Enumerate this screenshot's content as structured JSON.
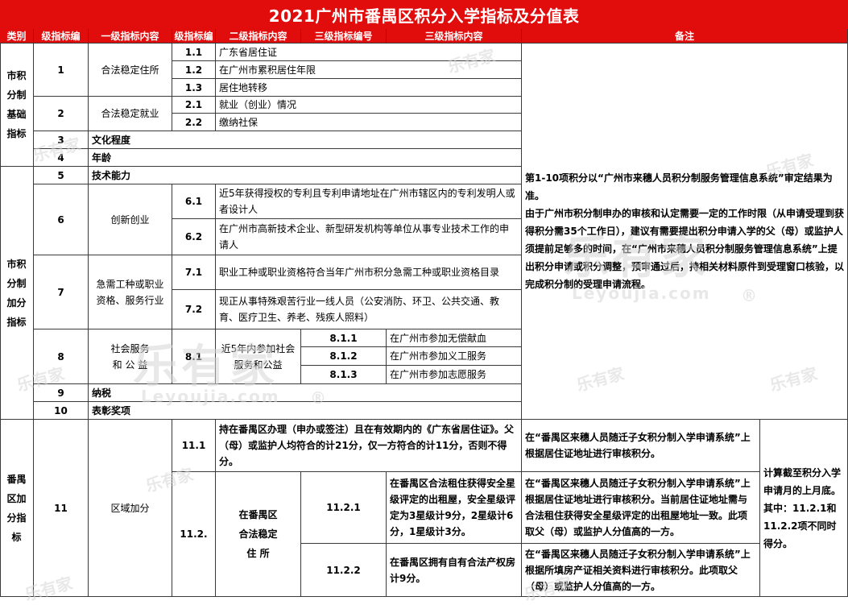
{
  "title": "2021广州市番禺区积分入学指标及分值表",
  "header": [
    "类别",
    "级指标编",
    "一级指标内容",
    "级指标编",
    "二级指标内容",
    "三级指标编号",
    "三级指标内容",
    "备注"
  ],
  "categories": {
    "basic": "市积分制基础指标",
    "bonus": "市积分制加分指标",
    "district": "番禺区加分指标"
  },
  "rows": {
    "r1_no": "1",
    "r1_name": "合法稳定住所",
    "r11_no": "1.1",
    "r11_text": "广东省居住证",
    "r12_no": "1.2",
    "r12_text": "在广州市累积居住年限",
    "r13_no": "1.3",
    "r13_text": "居住地转移",
    "r2_no": "2",
    "r2_name": "合法稳定就业",
    "r21_no": "2.1",
    "r21_text": "就业（创业）情况",
    "r22_no": "2.2",
    "r22_text": "缴纳社保",
    "r3_no": "3",
    "r3_name": "文化程度",
    "r4_no": "4",
    "r4_name": "年龄",
    "r5_no": "5",
    "r5_name": "技术能力",
    "r6_no": "6",
    "r6_name": "创新创业",
    "r61_no": "6.1",
    "r61_text": "近5年获得授权的专利且专利申请地址在广州市辖区内的专利发明人或者设计人",
    "r62_no": "6.2",
    "r62_text": "在广州市高新技术企业、新型研发机构等单位从事专业技术工作的申请人",
    "r7_no": "7",
    "r7_name": "急需工种或职业资格、服务行业",
    "r71_no": "7.1",
    "r71_text": "职业工种或职业资格符合当年广州市积分急需工种或职业资格目录",
    "r72_no": "7.2",
    "r72_text": "现正从事特殊艰苦行业一线人员（公安消防、环卫、公共交通、教育、医疗卫生、养老、残疾人照料）",
    "r8_no": "8",
    "r8_name": "社会服务\n和 公 益",
    "r81_no": "8.1",
    "r81_text": "近5年内参加社会服务和公益",
    "r811_no": "8.1.1",
    "r811_text": "在广州市参加无偿献血",
    "r812_no": "8.1.2",
    "r812_text": "在广州市参加义工服务",
    "r813_no": "8.1.3",
    "r813_text": "在广州市参加志愿服务",
    "r9_no": "9",
    "r9_name": "纳税",
    "r10_no": "10",
    "r10_name": "表彰奖项",
    "r11d_no": "11",
    "r11d_name": "区域加分",
    "r111_no": "11.1",
    "r111_text": "持在番禺区办理（申办或签注）且在有效期内的《广东省居住证》。父（母）或监护人均符合的计21分，仅一方符合的计11分，否则不得分。",
    "r111_note": "在“番禺区来穗人员随迁子女积分制入学申请系统”上根据居住证地址进行审核积分。",
    "r112_no": "11.2.",
    "r112_text": "在番禺区\n合法稳定\n住 所",
    "r1121_no": "11.2.1",
    "r1121_text": "在番禺区合法租住获得安全星级评定的出租屋，安全星级评定为3星级计9分，2星级计6分，1星级计3分。",
    "r1121_note": "在“番禺区来穗人员随迁子女积分制入学申请系统”上根据居住证地址进行审核积分。当前居住证地址需与合法租住获得安全星级评定的出租屋地址一致。此项取父（母）或监护人分值高的一方。",
    "r1122_no": "11.2.2",
    "r1122_text": "在番禺区拥有自有合法产权房计9分。",
    "r1122_note": "在“番禺区来穗人员随迁子女积分制入学申请系统”上根据所填房产证相关资料进行审核积分。此项取父（母）或监护人分值高的一方。",
    "r11_extra": "计算截至积分入学申请月的上月底。其中：11.2.1和11.2.2项不同时得分。"
  },
  "remark_main": "第1-10项积分以“广州市来穗人员积分制服务管理信息系统”审定结果为准。\n由于广州市积分制申办的审核和认定需要一定的工作时限（从申请受理到获得积分需35个工作日），建议有需要提出积分申请入学的父（母）或监护人须提前足够多的时间，在“广州市来穗人员积分制服务管理信息系统”上提出积分申请或积分调整，预审通过后，持相关材料原件到受理窗口核验，以完成积分制的受理申请流程。",
  "watermarks": {
    "brand": "乐有家",
    "domain": "Leyoujia.com",
    "reg": "®"
  },
  "colors": {
    "accent": "#e10c0c",
    "header_text": "#ffffff"
  }
}
